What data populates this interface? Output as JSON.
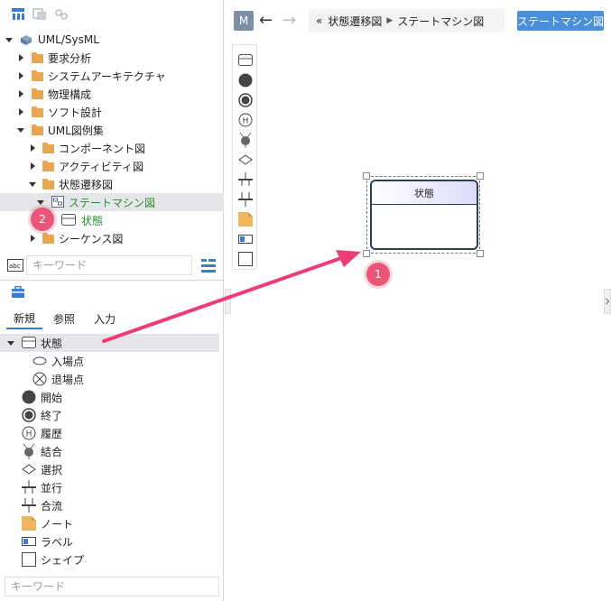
{
  "tree": {
    "root": "UML/SysML",
    "items": [
      "要求分析",
      "システムアーキテクチャ",
      "物理構成",
      "ソフト設計",
      "UML図例集",
      "コンポーネント図",
      "アクティビティ図",
      "状態遷移図",
      "ステートマシン図",
      "状態",
      "シーケンス図"
    ]
  },
  "tree_search": {
    "placeholder": "キーワード"
  },
  "palette": {
    "tabs": [
      "新規",
      "参照",
      "入力"
    ],
    "active_tab": "新規",
    "items": [
      "状態",
      "入場点",
      "退場点",
      "開始",
      "終了",
      "履歴",
      "結合",
      "選択",
      "並行",
      "合流",
      "ノート",
      "ラベル",
      "シェイプ"
    ],
    "search_placeholder": "キーワード"
  },
  "nav": {
    "m_label": "M",
    "back": "←",
    "forward": "→",
    "breadcrumb_prefix": "«",
    "breadcrumb": [
      "状態遷移図",
      "ステートマシン図"
    ],
    "diagram_type": "ステートマシン図"
  },
  "canvas": {
    "state_name": "状態"
  },
  "badges": {
    "one": "1",
    "two": "2"
  },
  "colors": {
    "accent": "#4a8fd8",
    "folder": "#e8a552",
    "green": "#2d8a2d",
    "badge": "#e8567a"
  },
  "icons": [
    "tree-view-icon",
    "copy-icon",
    "link-icon",
    "abc-field-icon",
    "filter-icon",
    "toolbox-icon"
  ]
}
